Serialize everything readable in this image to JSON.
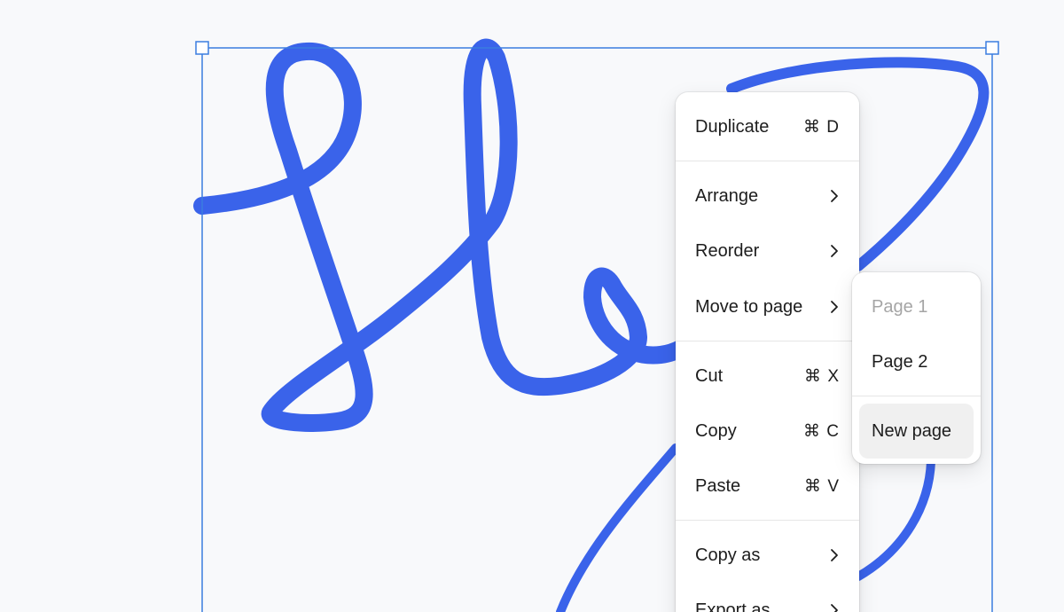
{
  "colors": {
    "stroke": "#3a63ea",
    "selection": "#3b7de0",
    "canvas_bg": "#f8f9fb",
    "menu_bg": "#ffffff",
    "disabled_text": "#a5a5a5",
    "highlight_bg": "#f0f0f0"
  },
  "context_menu": {
    "items": [
      {
        "label": "Duplicate",
        "shortcut": "⌘ D"
      },
      {
        "label": "Arrange",
        "icon": "chevron-right-icon"
      },
      {
        "label": "Reorder",
        "icon": "chevron-right-icon"
      },
      {
        "label": "Move to page",
        "icon": "chevron-right-icon"
      },
      {
        "label": "Cut",
        "shortcut": "⌘ X"
      },
      {
        "label": "Copy",
        "shortcut": "⌘ C"
      },
      {
        "label": "Paste",
        "shortcut": "⌘ V"
      },
      {
        "label": "Copy as",
        "icon": "chevron-right-icon"
      },
      {
        "label": "Export as",
        "icon": "chevron-right-icon"
      }
    ]
  },
  "submenu": {
    "items": [
      {
        "label": "Page 1",
        "state": "disabled"
      },
      {
        "label": "Page 2"
      },
      {
        "label": "New page",
        "state": "highlighted"
      }
    ]
  }
}
